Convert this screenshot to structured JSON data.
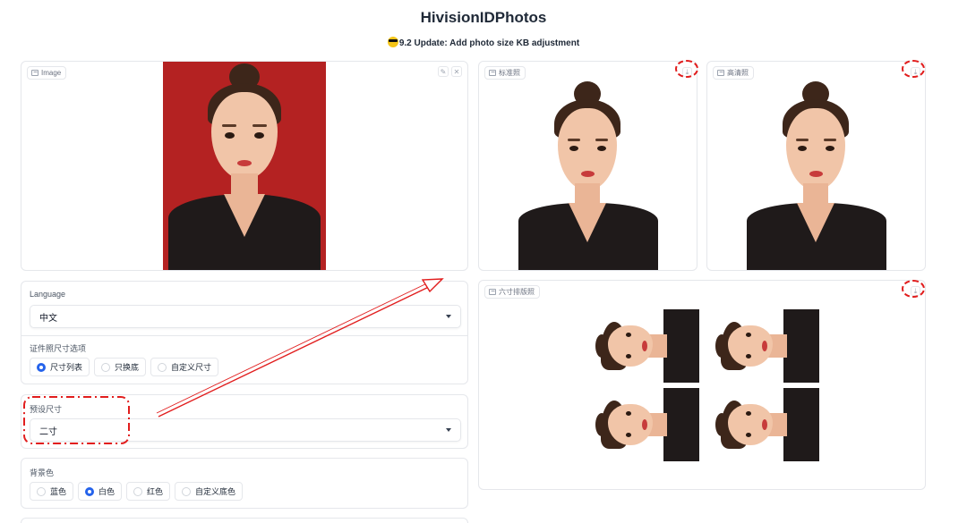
{
  "header": {
    "title": "HivisionIDPhotos",
    "subtitle": "9.2 Update: Add photo size KB adjustment",
    "subtitle_emoji": "sunglasses-emoji"
  },
  "input_image": {
    "label": "Image",
    "edit_icon": "pencil-icon",
    "clear_icon": "close-icon",
    "background_color": "#b42222"
  },
  "outputs": {
    "standard": {
      "label": "标准照"
    },
    "hd": {
      "label": "高清照"
    },
    "layout": {
      "label": "六寸排版照"
    },
    "download_icon": "download-icon"
  },
  "language": {
    "label": "Language",
    "value": "中文"
  },
  "size_mode": {
    "label": "证件照尺寸选项",
    "options": [
      "尺寸列表",
      "只换底",
      "自定义尺寸"
    ],
    "selected_index": 0
  },
  "preset_size": {
    "label": "预设尺寸",
    "value": "二寸"
  },
  "background": {
    "label": "背景色",
    "options": [
      "蓝色",
      "白色",
      "红色",
      "自定义底色"
    ],
    "selected_index": 1
  },
  "colors": {
    "accent": "#2563eb",
    "annotation_red": "#e11d1d",
    "photo_bg_red": "#b42222"
  }
}
